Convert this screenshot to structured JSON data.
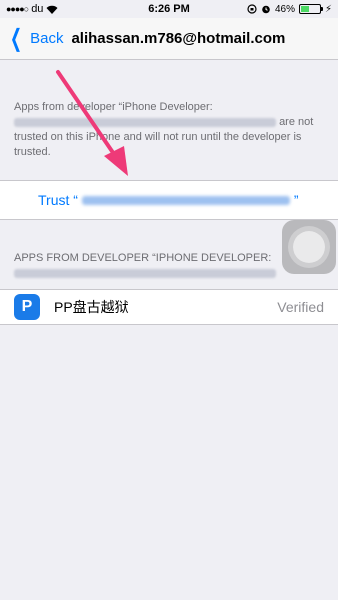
{
  "status_bar": {
    "signal": "●●●●○",
    "carrier": "du",
    "time": "6:26 PM",
    "battery_percent": "46%",
    "battery_level": 0.46
  },
  "nav": {
    "back_label": "Back",
    "title": "alihassan.m786@hotmail.com"
  },
  "description": {
    "prefix": "Apps from developer “iPhone Developer:",
    "suffix": "are not trusted on this iPhone and will not run until the developer is trusted."
  },
  "trust": {
    "label_prefix": "Trust “",
    "label_suffix": "”"
  },
  "apps_section": {
    "header": "APPS FROM DEVELOPER “IPHONE DEVELOPER:"
  },
  "apps": [
    {
      "name": "PP盘古越狱",
      "status": "Verified",
      "icon_letter": "P"
    }
  ],
  "colors": {
    "accent": "#007aff",
    "arrow": "#ee3a78",
    "background": "#efeff4"
  }
}
